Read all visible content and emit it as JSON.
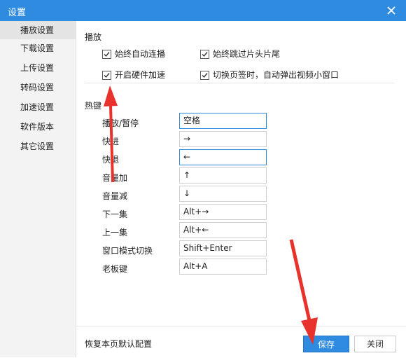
{
  "window": {
    "title": "设置"
  },
  "sidebar": {
    "items": [
      {
        "label": "播放设置"
      },
      {
        "label": "下载设置"
      },
      {
        "label": "上传设置"
      },
      {
        "label": "转码设置"
      },
      {
        "label": "加速设置"
      },
      {
        "label": "软件版本"
      },
      {
        "label": "其它设置"
      }
    ],
    "active": 0
  },
  "playback": {
    "section": "播放",
    "options": [
      {
        "label": "始终自动连播",
        "checked": true
      },
      {
        "label": "始终跳过片头片尾",
        "checked": true
      },
      {
        "label": "开启硬件加速",
        "checked": true
      },
      {
        "label": "切换页签时，自动弹出视频小窗口",
        "checked": true
      }
    ]
  },
  "hotkeys": {
    "section": "热键",
    "items": [
      {
        "label": "播放/暂停",
        "value": "空格"
      },
      {
        "label": "快进",
        "value": "→"
      },
      {
        "label": "快退",
        "value": "←"
      },
      {
        "label": "音量加",
        "value": "↑"
      },
      {
        "label": "音量减",
        "value": "↓"
      },
      {
        "label": "下一集",
        "value": "Alt+→"
      },
      {
        "label": "上一集",
        "value": "Alt+←"
      },
      {
        "label": "窗口模式切换",
        "value": "Shift+Enter"
      },
      {
        "label": "老板键",
        "value": "Alt+A"
      }
    ]
  },
  "footer": {
    "restore": "恢复本页默认配置",
    "save": "保存",
    "close": "关闭"
  },
  "colors": {
    "accent": "#2e8be0",
    "annotation": "#e8322b"
  }
}
